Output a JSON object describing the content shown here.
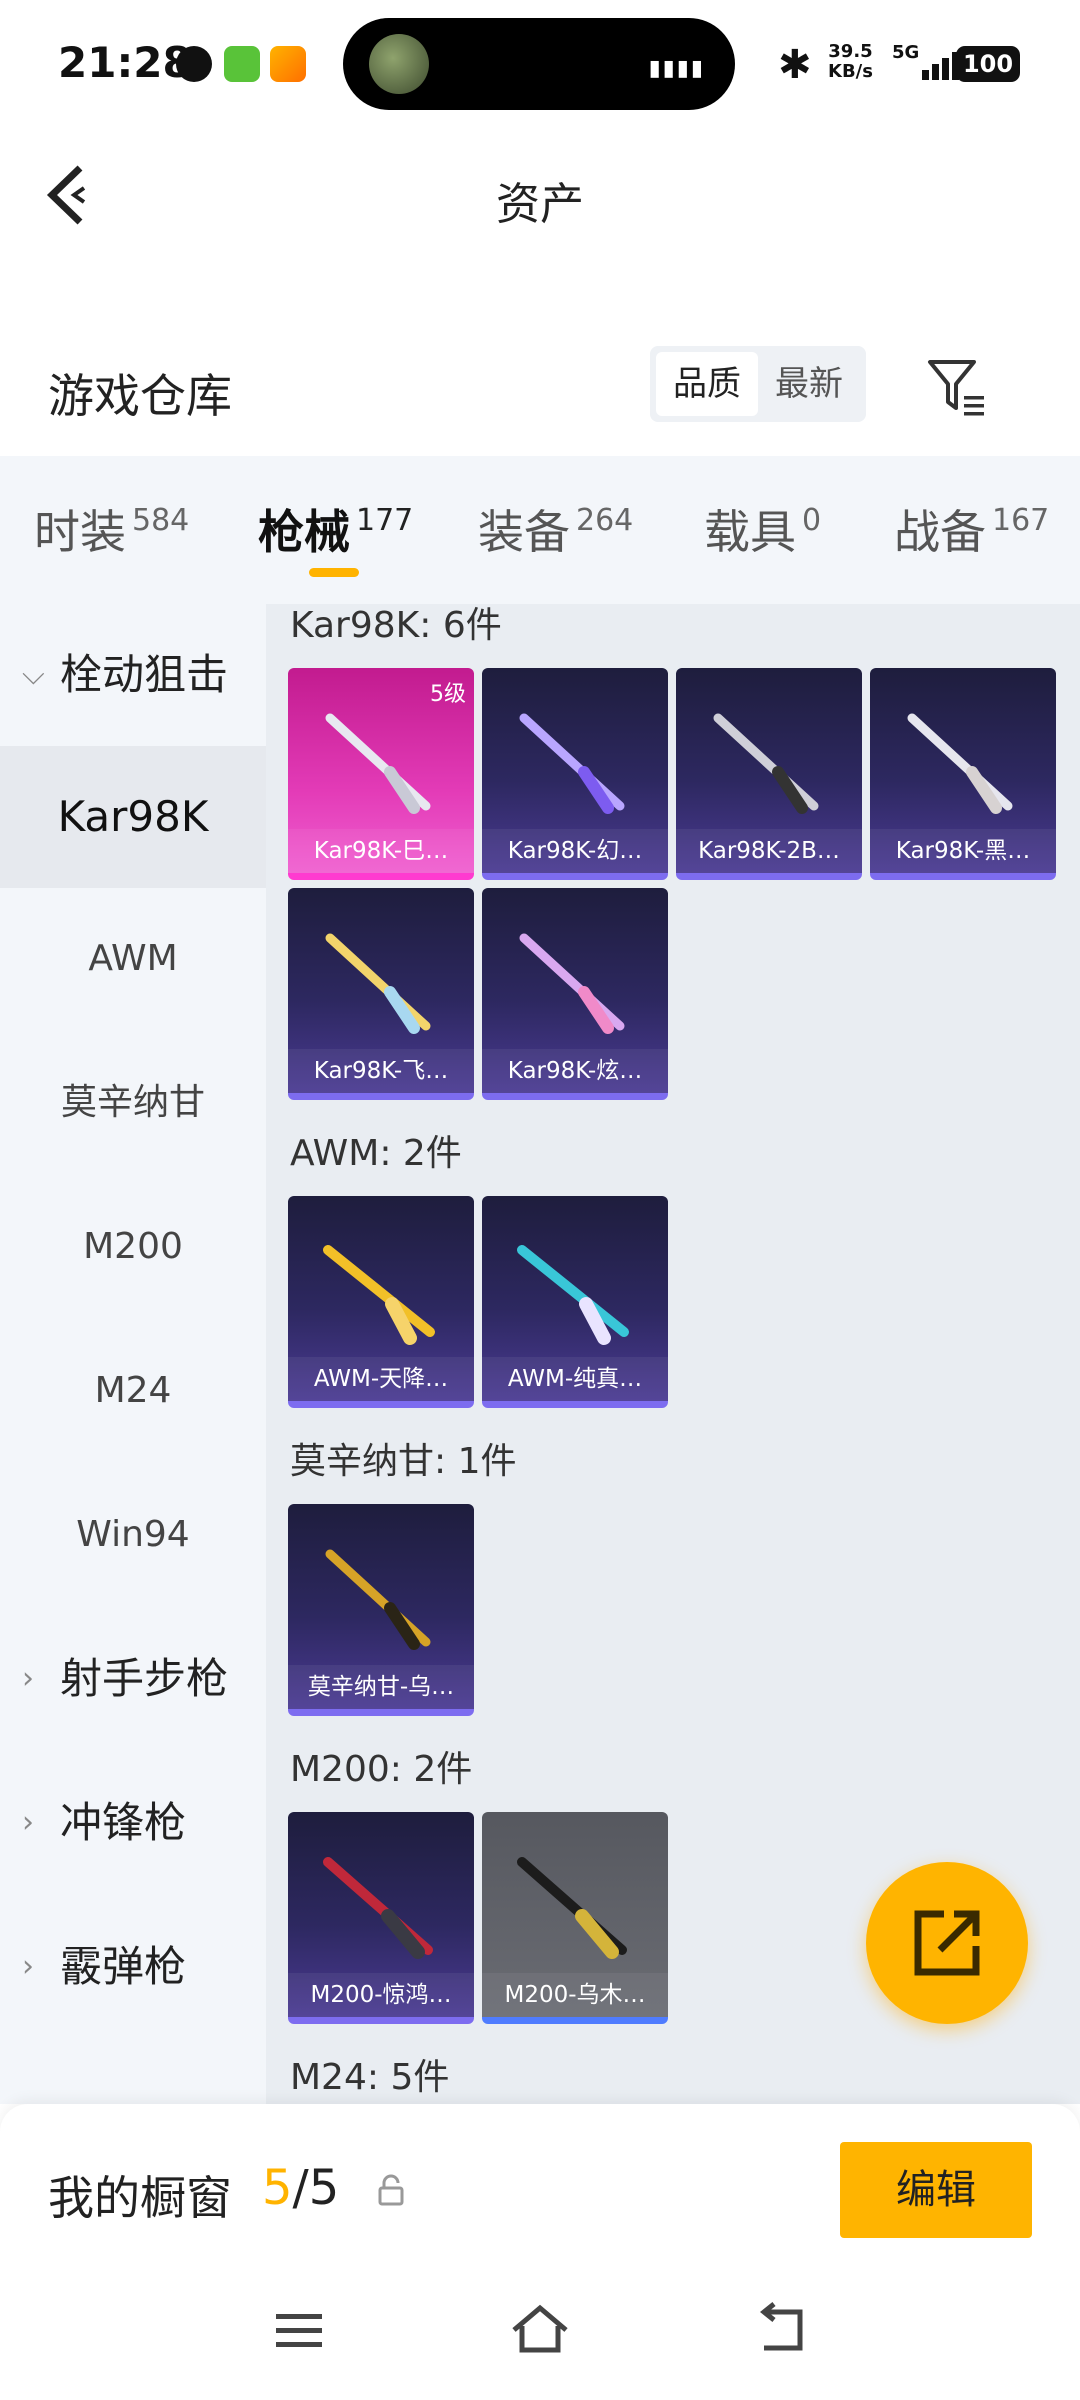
{
  "status_bar": {
    "time": "21:28",
    "net_speed_value": "39.5",
    "net_speed_unit": "KB/s",
    "network": "5G",
    "battery": "100"
  },
  "header": {
    "title": "资产"
  },
  "repository": {
    "title": "游戏仓库",
    "sort_options": [
      "品质",
      "最新"
    ]
  },
  "tabs": [
    {
      "label": "时装",
      "count": "584"
    },
    {
      "label": "枪械",
      "count": "177"
    },
    {
      "label": "装备",
      "count": "264"
    },
    {
      "label": "载具",
      "count": "0"
    },
    {
      "label": "战备",
      "count": "167"
    }
  ],
  "sidebar": {
    "groups": [
      "栓动狙击",
      "射手步枪",
      "冲锋枪",
      "霰弹枪"
    ],
    "sub_items": [
      "Kar98K",
      "AWM",
      "莫辛纳甘",
      "M200",
      "M24",
      "Win94"
    ]
  },
  "sections": [
    {
      "title": "Kar98K: 6件",
      "items": [
        {
          "name": "Kar98K-巳…",
          "level": "5级"
        },
        {
          "name": "Kar98K-幻…"
        },
        {
          "name": "Kar98K-2B…"
        },
        {
          "name": "Kar98K-黑…"
        },
        {
          "name": "Kar98K-飞…"
        },
        {
          "name": "Kar98K-炫…"
        }
      ]
    },
    {
      "title": "AWM: 2件",
      "items": [
        {
          "name": "AWM-天降…"
        },
        {
          "name": "AWM-纯真…"
        }
      ]
    },
    {
      "title": "莫辛纳甘: 1件",
      "items": [
        {
          "name": "莫辛纳甘-乌…"
        }
      ]
    },
    {
      "title": "M200: 2件",
      "items": [
        {
          "name": "M200-惊鸿…"
        },
        {
          "name": "M200-乌木…"
        }
      ]
    },
    {
      "title": "M24: 5件"
    }
  ],
  "showcase": {
    "label": "我的橱窗",
    "current": "5",
    "total": "/5",
    "edit_label": "编辑"
  },
  "colors": {
    "accent": "#ffb400",
    "card_purple": "#2d2860",
    "card_pink": "#e33bb7"
  }
}
